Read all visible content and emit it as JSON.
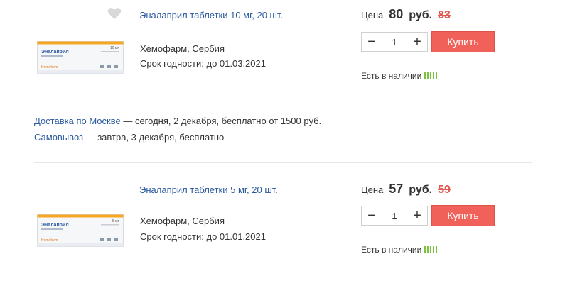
{
  "colors": {
    "link": "#2b5aa0",
    "buy_button": "#f06259",
    "old_price": "#e05a50",
    "stock_bar": "#7cc23d"
  },
  "products": [
    {
      "title": "Эналаприл таблетки 10 мг, 20 шт.",
      "manufacturer": "Хемофарм, Сербия",
      "expiry": "Срок годности: до 01.03.2021",
      "price_label": "Цена",
      "price": "80",
      "currency": "руб.",
      "old_price": "83",
      "quantity": "1",
      "buy_label": "Купить",
      "stock_label": "Есть в наличии",
      "box_brand": "Эналаприл",
      "box_dose": "10 мг",
      "box_maker": "Hemofarm",
      "favorite_icon": "heart-icon"
    },
    {
      "title": "Эналаприл таблетки 5 мг, 20 шт.",
      "manufacturer": "Хемофарм, Сербия",
      "expiry": "Срок годности: до 01.01.2021",
      "price_label": "Цена",
      "price": "57",
      "currency": "руб.",
      "old_price": "59",
      "quantity": "1",
      "buy_label": "Купить",
      "stock_label": "Есть в наличии",
      "box_brand": "Эналаприл",
      "box_dose": "5 мг",
      "box_maker": "Hemofarm"
    }
  ],
  "delivery": {
    "moscow_link": "Доставка по Москве",
    "moscow_text": " — сегодня, 2 декабря, бесплатно от 1500 руб.",
    "pickup_link": "Самовывоз",
    "pickup_text": " — завтра, 3 декабря, бесплатно"
  }
}
